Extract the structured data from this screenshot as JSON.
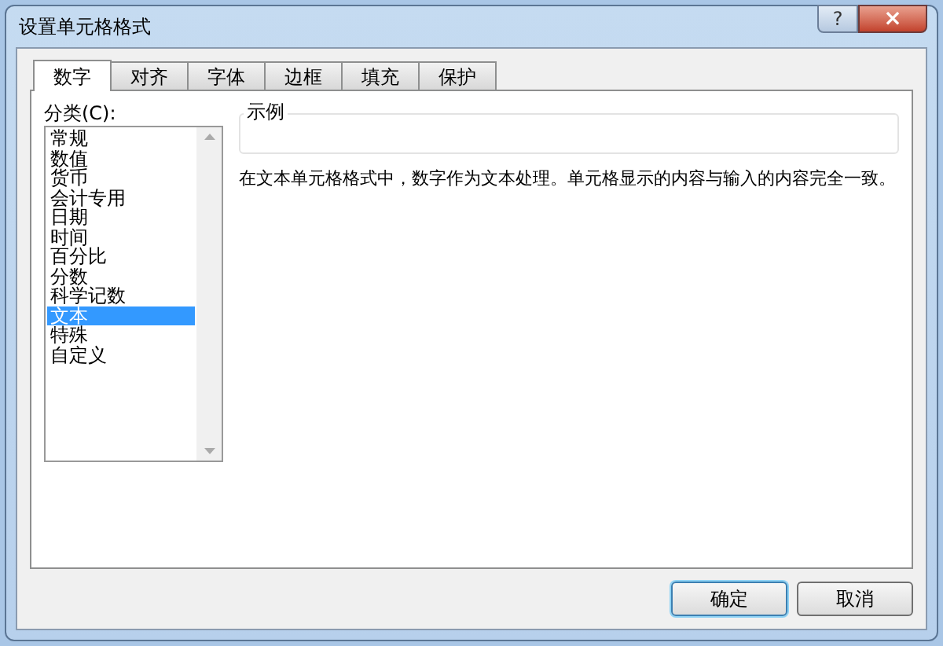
{
  "window": {
    "title": "设置单元格格式",
    "help": "?",
    "close": "×"
  },
  "tabs": [
    {
      "label": "数字",
      "selected": true
    },
    {
      "label": "对齐",
      "selected": false
    },
    {
      "label": "字体",
      "selected": false
    },
    {
      "label": "边框",
      "selected": false
    },
    {
      "label": "填充",
      "selected": false
    },
    {
      "label": "保护",
      "selected": false
    }
  ],
  "category": {
    "label": "分类(C):",
    "items": [
      {
        "label": "常规",
        "selected": false
      },
      {
        "label": "数值",
        "selected": false
      },
      {
        "label": "货币",
        "selected": false
      },
      {
        "label": "会计专用",
        "selected": false
      },
      {
        "label": "日期",
        "selected": false
      },
      {
        "label": "时间",
        "selected": false
      },
      {
        "label": "百分比",
        "selected": false
      },
      {
        "label": "分数",
        "selected": false
      },
      {
        "label": "科学记数",
        "selected": false
      },
      {
        "label": "文本",
        "selected": true
      },
      {
        "label": "特殊",
        "selected": false
      },
      {
        "label": "自定义",
        "selected": false
      }
    ]
  },
  "sample": {
    "label": "示例"
  },
  "description": "在文本单元格格式中，数字作为文本处理。单元格显示的内容与输入的内容完全一致。",
  "buttons": [
    {
      "label": "确定",
      "default": true
    },
    {
      "label": "取消",
      "default": false
    }
  ]
}
